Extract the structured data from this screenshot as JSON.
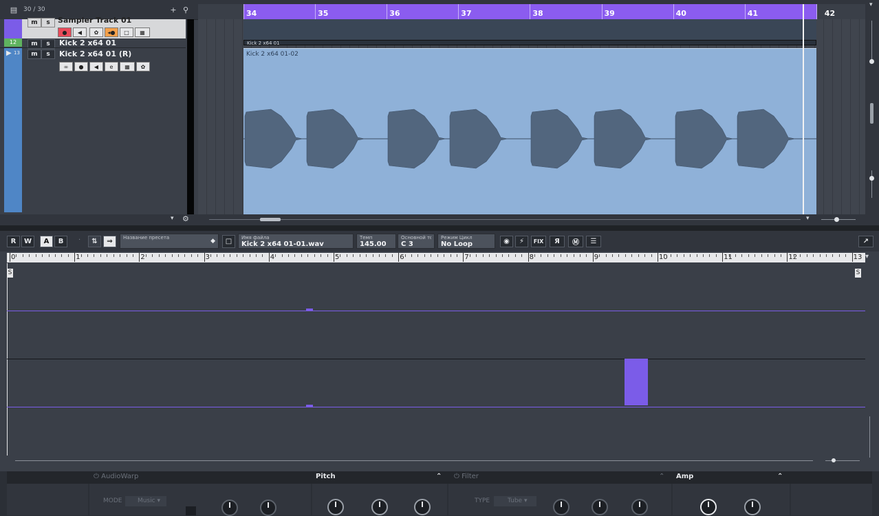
{
  "project": {
    "track_count": "30 / 30",
    "add_icon": "plus-icon",
    "search_icon": "search-icon",
    "tracks": [
      {
        "name": "Sampler Track 01",
        "mute": "m",
        "solo": "s"
      },
      {
        "name": "Kick 2 x64 01",
        "mute": "m",
        "solo": "s",
        "badge": "12"
      },
      {
        "name": "Kick 2 x64 01 (R)",
        "mute": "m",
        "solo": "s",
        "number": "13"
      }
    ],
    "ruler_bars": [
      "34",
      "35",
      "36",
      "37",
      "38",
      "39",
      "40",
      "41",
      "42"
    ],
    "clip_strip_name": "Kick 2 x64 01",
    "clip_name": "Kick 2 x64 01-02",
    "colors": {
      "ruler": "#8b5cf0",
      "clip": "#8fb1d8",
      "waveform": "#52667e",
      "track_selected": "#4f86c6"
    }
  },
  "editor": {
    "buttons": {
      "read": "R",
      "write": "W",
      "a": "A",
      "b": "B"
    },
    "preset": {
      "label": "Название пресета",
      "value": ""
    },
    "file": {
      "label": "Имя файла",
      "value": "Kick 2 x64 01-01.wav"
    },
    "tempo": {
      "label": "Темп",
      "value": "145.00"
    },
    "root": {
      "label": "Основной то",
      "value": "C  3"
    },
    "loop": {
      "label": "Режим Цикл",
      "value": "No Loop"
    },
    "icon_buttons": [
      "FIX",
      "Я"
    ],
    "ruler_numbers": [
      "0",
      "1",
      "2",
      "3",
      "4",
      "5",
      "6",
      "7",
      "8",
      "9",
      "10",
      "11",
      "12",
      "13"
    ],
    "marker_start": "S",
    "marker_end": "S",
    "colors": {
      "envelope": "#7b5ce8"
    }
  },
  "panel": {
    "audiowarp": "AudioWarp",
    "mode_label": "MODE",
    "mode_value": "Music",
    "pitch": "Pitch",
    "filter": "Filter",
    "type_label": "TYPE",
    "type_value": "Tube",
    "amp": "Amp"
  }
}
